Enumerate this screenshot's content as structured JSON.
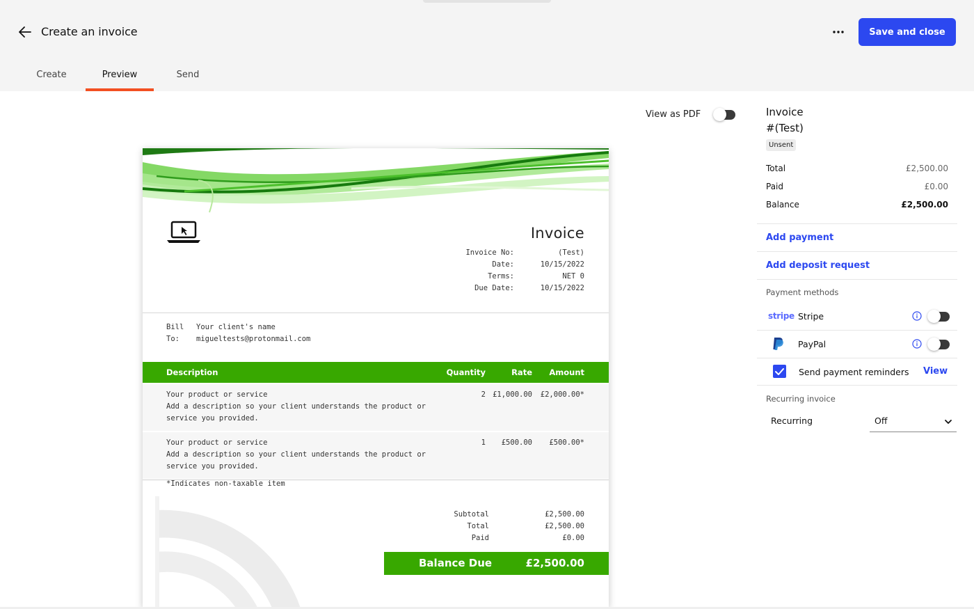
{
  "header": {
    "title": "Create an invoice",
    "save_label": "Save and close",
    "tabs": [
      {
        "label": "Create"
      },
      {
        "label": "Preview"
      },
      {
        "label": "Send"
      }
    ],
    "active_tab": "Preview",
    "accent_color": "#f25022",
    "button_color": "#2c48f0"
  },
  "preview": {
    "view_as_pdf_label": "View as PDF",
    "view_as_pdf_on": false
  },
  "invoice": {
    "title": "Invoice",
    "meta": {
      "number_label": "Invoice No:",
      "number": "(Test)",
      "date_label": "Date:",
      "date": "10/15/2022",
      "terms_label": "Terms:",
      "terms": "NET 0",
      "due_label": "Due Date:",
      "due": "10/15/2022"
    },
    "bill_to": {
      "label_line1": "Bill",
      "label_line2": "To:",
      "name": "Your client's name",
      "email": "migueltests@protonmail.com"
    },
    "columns": {
      "description": "Description",
      "quantity": "Quantity",
      "rate": "Rate",
      "amount": "Amount"
    },
    "items": [
      {
        "name": "Your product or service",
        "description": "Add a description so your client understands the product or service you provided.",
        "quantity": "2",
        "rate": "£1,000.00",
        "amount": "£2,000.00*"
      },
      {
        "name": "Your product or service",
        "description": "Add a description so your client understands the product or service you provided.",
        "quantity": "1",
        "rate": "£500.00",
        "amount": "£500.00*"
      }
    ],
    "note": "*Indicates non-taxable item",
    "totals": {
      "subtotal_label": "Subtotal",
      "subtotal": "£2,500.00",
      "total_label": "Total",
      "total": "£2,500.00",
      "paid_label": "Paid",
      "paid": "£0.00"
    },
    "balance_due_label": "Balance Due",
    "balance_due": "£2,500.00",
    "theme_color": "#38a800"
  },
  "sidebar": {
    "title_line1": "Invoice",
    "title_line2": "#(Test)",
    "status": "Unsent",
    "summary": {
      "total_label": "Total",
      "total": "£2,500.00",
      "paid_label": "Paid",
      "paid": "£0.00",
      "balance_label": "Balance",
      "balance": "£2,500.00"
    },
    "add_payment": "Add payment",
    "add_deposit": "Add deposit request",
    "payment_methods_label": "Payment methods",
    "payment_methods": [
      {
        "logo": "stripe",
        "name": "Stripe",
        "enabled": false
      },
      {
        "logo": "paypal-icon",
        "name": "PayPal",
        "enabled": false
      }
    ],
    "reminders": {
      "label": "Send payment reminders",
      "checked": true,
      "view_label": "View"
    },
    "recurring_label": "Recurring invoice",
    "recurring": {
      "label": "Recurring",
      "value": "Off"
    }
  }
}
